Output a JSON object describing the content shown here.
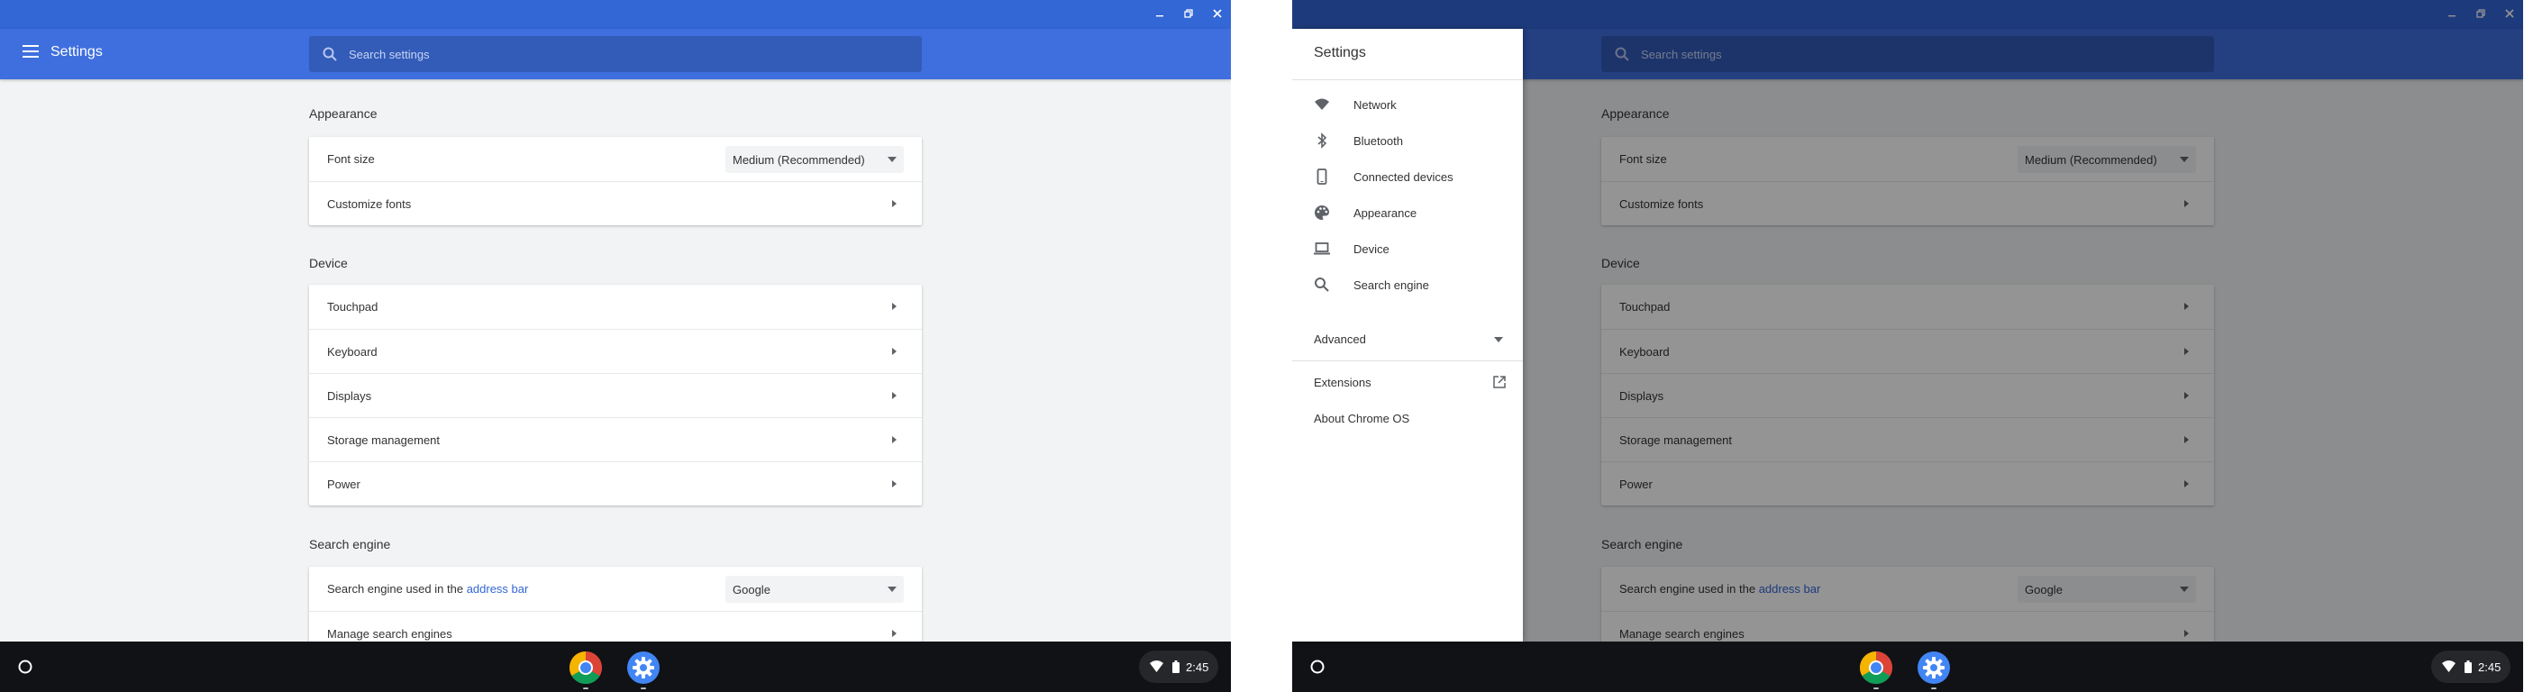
{
  "toolbar": {
    "title": "Settings",
    "search_placeholder": "Search settings"
  },
  "sections": {
    "appearance": {
      "title": "Appearance",
      "font_size_label": "Font size",
      "font_size_value": "Medium (Recommended)",
      "customize_fonts_label": "Customize fonts"
    },
    "device": {
      "title": "Device",
      "items": [
        "Touchpad",
        "Keyboard",
        "Displays",
        "Storage management",
        "Power"
      ]
    },
    "search_engine": {
      "title": "Search engine",
      "used_in_prefix": "Search engine used in the",
      "used_in_link": "address bar",
      "engine_value": "Google",
      "manage_label": "Manage search engines"
    }
  },
  "drawer": {
    "title": "Settings",
    "items": [
      {
        "label": "Network",
        "icon": "wifi-icon"
      },
      {
        "label": "Bluetooth",
        "icon": "bluetooth-icon"
      },
      {
        "label": "Connected devices",
        "icon": "phone-icon"
      },
      {
        "label": "Appearance",
        "icon": "palette-icon"
      },
      {
        "label": "Device",
        "icon": "laptop-icon"
      },
      {
        "label": "Search engine",
        "icon": "search-icon"
      }
    ],
    "advanced_label": "Advanced",
    "extensions_label": "Extensions",
    "about_label": "About Chrome OS"
  },
  "shelf": {
    "apps": [
      "chrome-icon",
      "settings-icon"
    ],
    "clock": "2:45"
  },
  "colors": {
    "titlebar": "#3367d6",
    "toolbar": "#3f6fde",
    "link": "#3367d6",
    "shelf": "#101216"
  }
}
